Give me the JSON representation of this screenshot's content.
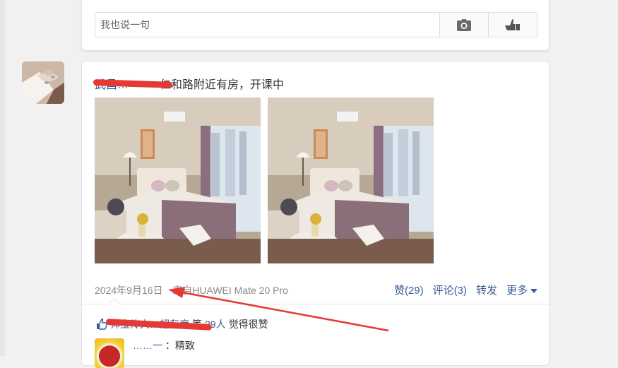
{
  "composer": {
    "placeholder": "我也说一句",
    "camera_icon": "camera-icon",
    "like_icon": "thumb-icon"
  },
  "post": {
    "author_name": "武昌…",
    "body": "仁和路附近有房，开课中",
    "photos": [
      "bedroom-photo",
      "bedroom-photo"
    ],
    "date": "2024年9月16日",
    "source": "来自HUAWEI Mate 20 Pro",
    "actions": {
      "like": "赞(29)",
      "comment": "评论(3)",
      "repost": "转发",
      "more": "更多"
    },
    "likes": {
      "names": "帅宝传大…超有度",
      "prefix": "等",
      "count": "29人",
      "suffix": "觉得很赞"
    },
    "comments": [
      {
        "user": "……一",
        "text": "：精致"
      }
    ]
  },
  "annotations": {
    "redaction_color": "#e53935",
    "arrow_color": "#e53935"
  }
}
